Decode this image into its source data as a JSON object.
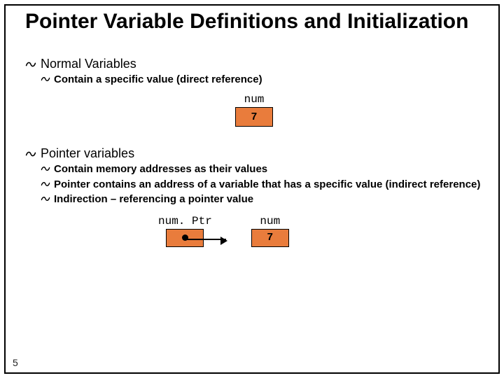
{
  "title": "Pointer Variable Definitions and Initialization",
  "section1": {
    "heading": "Normal Variables",
    "points": [
      "Contain a specific value (direct reference)"
    ],
    "diagram": {
      "label": "num",
      "value": "7"
    }
  },
  "section2": {
    "heading": "Pointer variables",
    "points": [
      "Contain memory addresses as their values",
      "Pointer contains an address of a variable that has a specific value (indirect reference)",
      "Indirection – referencing a pointer value"
    ],
    "diagram": {
      "ptr_label": "num. Ptr",
      "target_label": "num",
      "target_value": "7"
    }
  },
  "page_number": "5"
}
